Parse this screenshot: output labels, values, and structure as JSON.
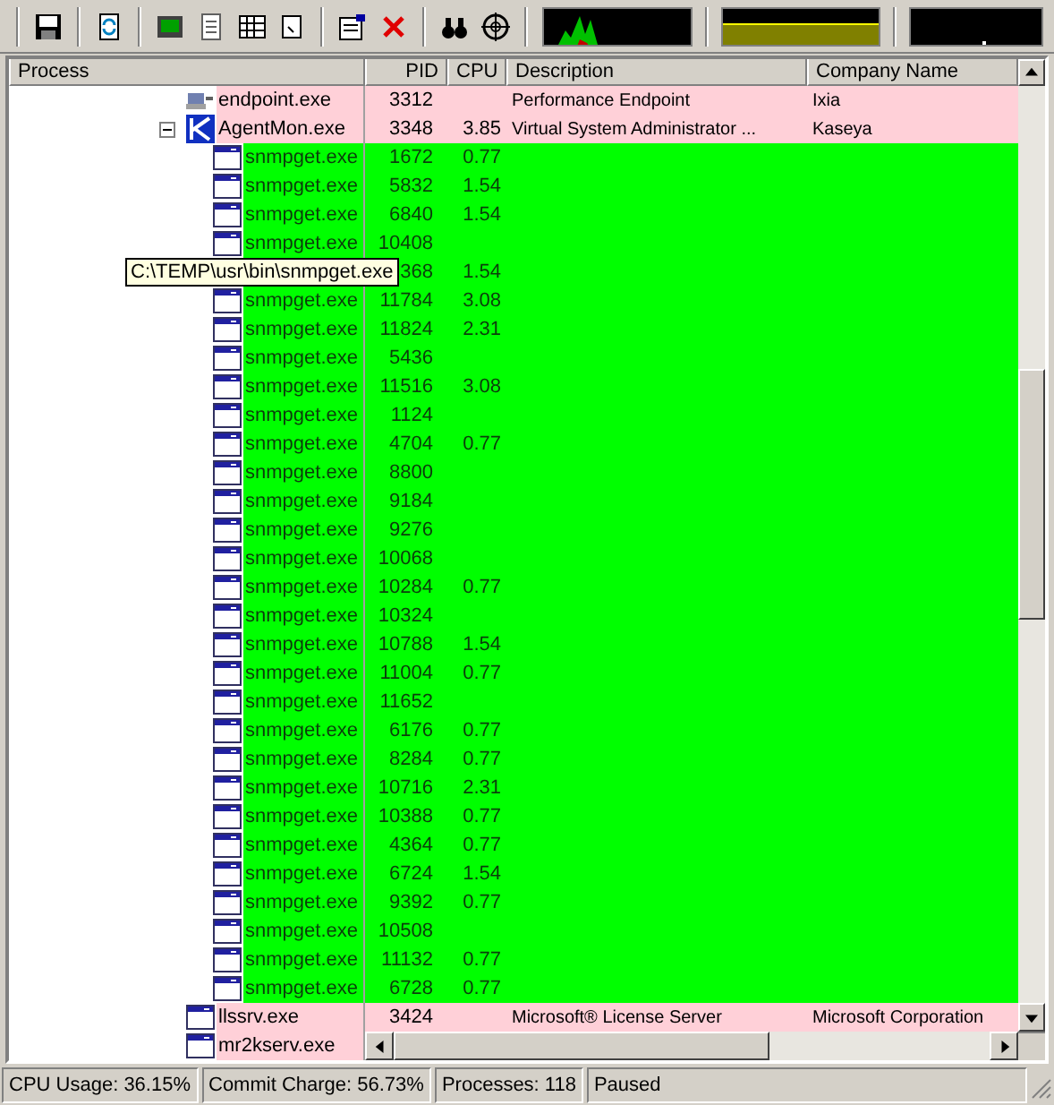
{
  "columns": [
    "Process",
    "PID",
    "CPU",
    "Description",
    "Company Name"
  ],
  "rows": [
    {
      "kind": "service",
      "name": "endpoint.exe",
      "pid": "3312",
      "description": "Performance Endpoint",
      "company": "Ixia"
    },
    {
      "kind": "service",
      "name": "AgentMon.exe",
      "pid": "3348",
      "cpu": "3.85",
      "description": "Virtual System Administrator ...",
      "company": "Kaseya",
      "expanded": true,
      "children": [
        {
          "kind": "new",
          "name": "snmpget.exe",
          "pid": "1672",
          "cpu": "0.77"
        },
        {
          "kind": "new",
          "name": "snmpget.exe",
          "pid": "5832",
          "cpu": "1.54"
        },
        {
          "kind": "new",
          "name": "snmpget.exe",
          "pid": "6840",
          "cpu": "1.54"
        },
        {
          "kind": "new",
          "name": "snmpget.exe",
          "pid": "10408"
        },
        {
          "kind": "new",
          "pid": "368",
          "cpu": "1.54"
        },
        {
          "kind": "new",
          "name": "snmpget.exe",
          "pid": "11784",
          "cpu": "3.08"
        },
        {
          "kind": "new",
          "name": "snmpget.exe",
          "pid": "11824",
          "cpu": "2.31"
        },
        {
          "kind": "new",
          "name": "snmpget.exe",
          "pid": "5436"
        },
        {
          "kind": "new",
          "name": "snmpget.exe",
          "pid": "11516",
          "cpu": "3.08"
        },
        {
          "kind": "new",
          "name": "snmpget.exe",
          "pid": "1124"
        },
        {
          "kind": "new",
          "name": "snmpget.exe",
          "pid": "4704",
          "cpu": "0.77"
        },
        {
          "kind": "new",
          "name": "snmpget.exe",
          "pid": "8800"
        },
        {
          "kind": "new",
          "name": "snmpget.exe",
          "pid": "9184"
        },
        {
          "kind": "new",
          "name": "snmpget.exe",
          "pid": "9276"
        },
        {
          "kind": "new",
          "name": "snmpget.exe",
          "pid": "10068"
        },
        {
          "kind": "new",
          "name": "snmpget.exe",
          "pid": "10284",
          "cpu": "0.77"
        },
        {
          "kind": "new",
          "name": "snmpget.exe",
          "pid": "10324"
        },
        {
          "kind": "new",
          "name": "snmpget.exe",
          "pid": "10788",
          "cpu": "1.54"
        },
        {
          "kind": "new",
          "name": "snmpget.exe",
          "pid": "11004",
          "cpu": "0.77"
        },
        {
          "kind": "new",
          "name": "snmpget.exe",
          "pid": "11652"
        },
        {
          "kind": "new",
          "name": "snmpget.exe",
          "pid": "6176",
          "cpu": "0.77"
        },
        {
          "kind": "new",
          "name": "snmpget.exe",
          "pid": "8284",
          "cpu": "0.77"
        },
        {
          "kind": "new",
          "name": "snmpget.exe",
          "pid": "10716",
          "cpu": "2.31"
        },
        {
          "kind": "new",
          "name": "snmpget.exe",
          "pid": "10388",
          "cpu": "0.77"
        },
        {
          "kind": "new",
          "name": "snmpget.exe",
          "pid": "4364",
          "cpu": "0.77"
        },
        {
          "kind": "new",
          "name": "snmpget.exe",
          "pid": "6724",
          "cpu": "1.54"
        },
        {
          "kind": "new",
          "name": "snmpget.exe",
          "pid": "9392",
          "cpu": "0.77"
        },
        {
          "kind": "new",
          "name": "snmpget.exe",
          "pid": "10508"
        },
        {
          "kind": "new",
          "name": "snmpget.exe",
          "pid": "11132",
          "cpu": "0.77"
        },
        {
          "kind": "new",
          "name": "snmpget.exe",
          "pid": "6728",
          "cpu": "0.77"
        }
      ]
    },
    {
      "kind": "service",
      "name": "llssrv.exe",
      "pid": "3424",
      "description": "Microsoft® License Server",
      "company": "Microsoft Corporation"
    },
    {
      "kind": "service",
      "name": "mr2kserv.exe"
    }
  ],
  "tooltip": "C:\\TEMP\\usr\\bin\\snmpget.exe",
  "status_bar": [
    "CPU Usage: 36.15%",
    "Commit Charge: 56.73%",
    "Processes: 118",
    "Paused"
  ]
}
